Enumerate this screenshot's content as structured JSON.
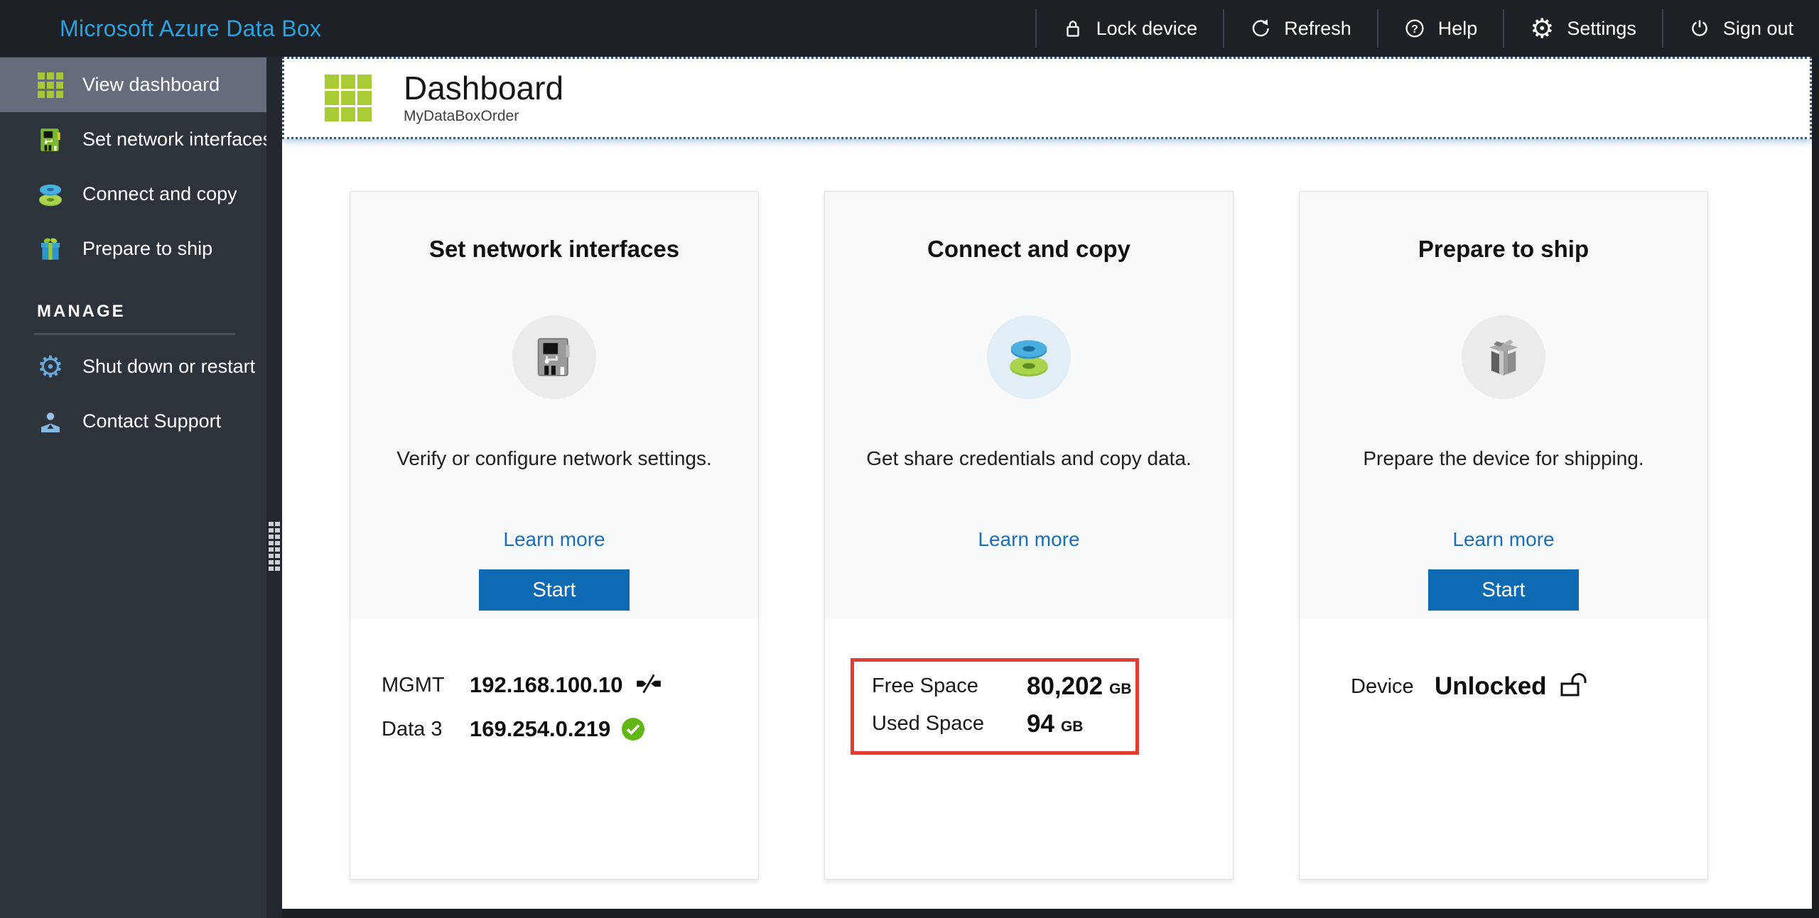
{
  "topbar": {
    "title": "Microsoft Azure Data Box",
    "actions": [
      {
        "label": "Lock device",
        "icon": "lock-icon"
      },
      {
        "label": "Refresh",
        "icon": "refresh-icon"
      },
      {
        "label": "Help",
        "icon": "help-icon"
      },
      {
        "label": "Settings",
        "icon": "settings-gear-icon"
      },
      {
        "label": "Sign out",
        "icon": "power-icon"
      }
    ]
  },
  "sidebar": {
    "items": [
      {
        "label": "View dashboard",
        "icon": "dashboard-grid-icon",
        "selected": true
      },
      {
        "label": "Set network interfaces",
        "icon": "network-card-icon",
        "selected": false
      },
      {
        "label": "Connect and copy",
        "icon": "disks-icon",
        "selected": false
      },
      {
        "label": "Prepare to ship",
        "icon": "gift-box-icon",
        "selected": false
      }
    ],
    "manage_label": "MANAGE",
    "manage_items": [
      {
        "label": "Shut down or restart",
        "icon": "gear-power-icon"
      },
      {
        "label": "Contact Support",
        "icon": "support-person-icon"
      }
    ]
  },
  "header": {
    "title": "Dashboard",
    "subtitle": "MyDataBoxOrder"
  },
  "cards": [
    {
      "title": "Set network interfaces",
      "description": "Verify or configure network settings.",
      "learn_more_label": "Learn more",
      "start_label": "Start",
      "rows": [
        {
          "label": "MGMT",
          "value": "192.168.100.10",
          "status_icon": "disconnected-icon"
        },
        {
          "label": "Data 3",
          "value": "169.254.0.219",
          "status_icon": "connected-check-icon"
        }
      ]
    },
    {
      "title": "Connect and copy",
      "description": "Get share credentials and copy data.",
      "learn_more_label": "Learn more",
      "stats": [
        {
          "label": "Free Space",
          "value": "80,202",
          "unit": "GB"
        },
        {
          "label": "Used Space",
          "value": "94",
          "unit": "GB"
        }
      ],
      "highlight_border_color": "#e23d33"
    },
    {
      "title": "Prepare to ship",
      "description": "Prepare the device for shipping.",
      "learn_more_label": "Learn more",
      "start_label": "Start",
      "rows": [
        {
          "label": "Device",
          "value": "Unlocked",
          "status_icon": "unlock-icon"
        }
      ]
    }
  ],
  "colors": {
    "brand_blue": "#2ba2e0",
    "start_button_blue": "#0f6ab4",
    "link_blue": "#1b6fba",
    "highlight_red": "#e23d33",
    "status_green": "#62b715",
    "sidebar_green": "#a5c936",
    "selected_item_gray": "#656d7d"
  }
}
